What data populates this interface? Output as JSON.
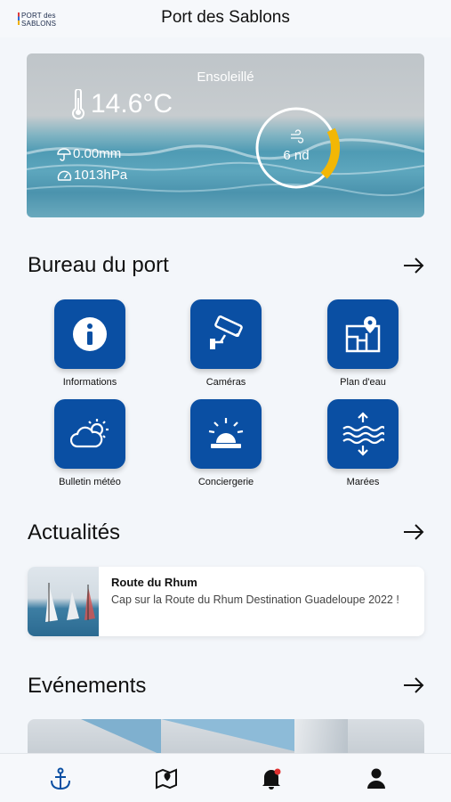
{
  "header": {
    "logo_line1": "PORT des",
    "logo_line2": "SABLONS",
    "title": "Port des Sablons"
  },
  "weather": {
    "condition": "Ensoleillé",
    "temperature": "14.6°C",
    "rain": "0.00mm",
    "pressure": "1013hPa",
    "wind": "6 nd",
    "wind_level": 0.2,
    "accent_color": "#f2b705"
  },
  "office": {
    "title": "Bureau du port",
    "tiles": [
      {
        "label": "Informations",
        "icon": "info-icon"
      },
      {
        "label": "Caméras",
        "icon": "camera-icon"
      },
      {
        "label": "Plan d'eau",
        "icon": "map-pin-icon"
      },
      {
        "label": "Bulletin météo",
        "icon": "weather-icon"
      },
      {
        "label": "Conciergerie",
        "icon": "bell-siren-icon"
      },
      {
        "label": "Marées",
        "icon": "tide-icon"
      }
    ],
    "tile_color": "#0a4fa3"
  },
  "news": {
    "title": "Actualités",
    "items": [
      {
        "title": "Route du Rhum",
        "text": "Cap sur la Route du Rhum Destination Guadeloupe 2022 !"
      }
    ]
  },
  "events": {
    "title": "Evénements"
  },
  "nav": {
    "items": [
      "anchor-icon",
      "map-icon",
      "notification-bell-icon",
      "profile-icon"
    ]
  }
}
